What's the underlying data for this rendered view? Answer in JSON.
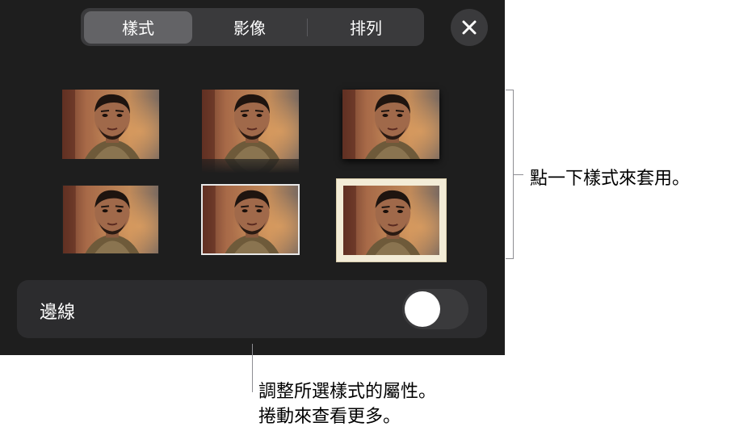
{
  "tabs": [
    {
      "label": "樣式",
      "active": true
    },
    {
      "label": "影像",
      "active": false
    },
    {
      "label": "排列",
      "active": false
    }
  ],
  "close_icon": "close-icon",
  "style_thumbnails": [
    {
      "style": "plain"
    },
    {
      "style": "reflection"
    },
    {
      "style": "drop-shadow"
    },
    {
      "style": "thin-dark-border"
    },
    {
      "style": "thin-white-border"
    },
    {
      "style": "cream-mat-frame",
      "selected": true
    }
  ],
  "border_row": {
    "label": "邊線",
    "toggle_on": false
  },
  "callouts": {
    "styles_hint": "點一下樣式來套用。",
    "bottom_line1": "調整所選樣式的屬性。",
    "bottom_line2": "捲動來查看更多。"
  },
  "colors": {
    "panel_bg": "#1e1e1e",
    "segment_bg": "#3a3a3c",
    "segment_active": "#636366",
    "frame_cream": "#f3ecd7"
  }
}
